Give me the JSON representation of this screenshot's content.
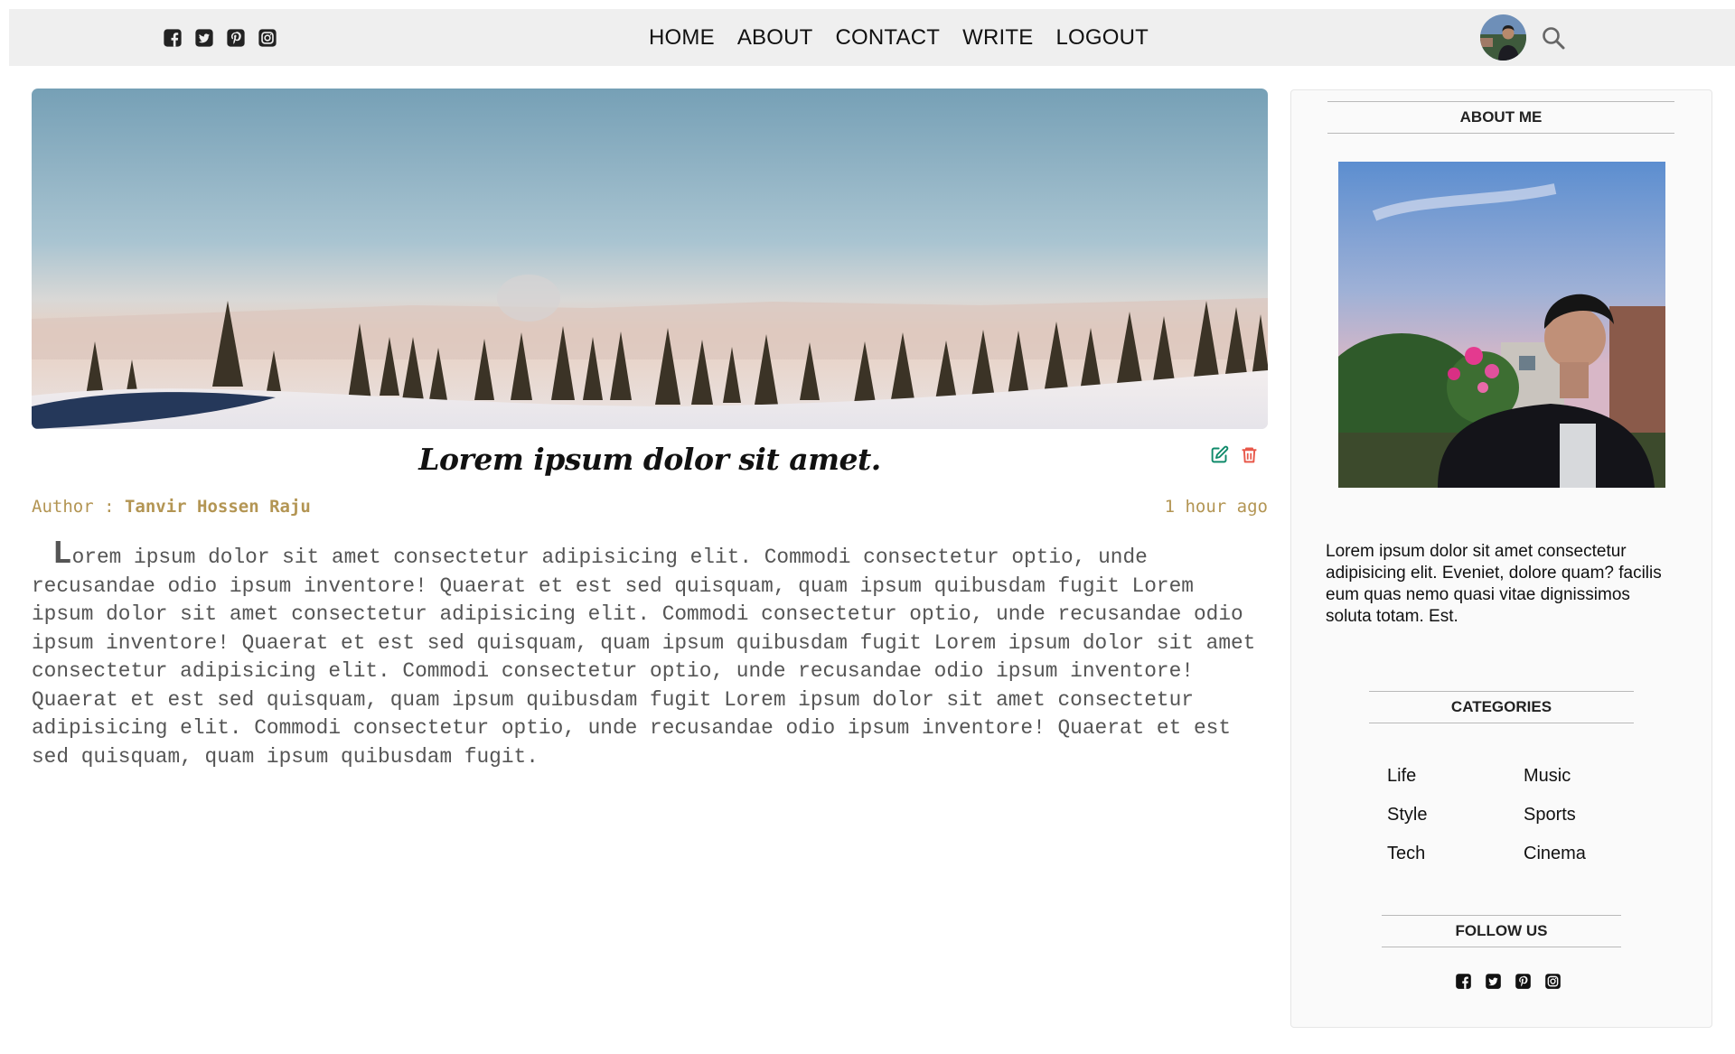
{
  "header": {
    "social_icons": [
      "facebook-icon",
      "twitter-icon",
      "pinterest-icon",
      "instagram-icon"
    ],
    "nav": [
      "HOME",
      "ABOUT",
      "CONTACT",
      "WRITE",
      "LOGOUT"
    ],
    "avatar_icon": "avatar",
    "search_icon": "search-icon",
    "background_color": "#efefef"
  },
  "post": {
    "title": "Lorem ipsum dolor sit amet.",
    "author_label": "Author : ",
    "author_name": "Tanvir Hossen Raju",
    "time": "1 hour ago",
    "body": "Lorem ipsum dolor sit amet consectetur adipisicing elit. Commodi consectetur optio, unde recusandae odio ipsum inventore! Quaerat et est sed quisquam, quam ipsum quibusdam fugit Lorem ipsum dolor sit amet consectetur adipisicing elit. Commodi consectetur optio, unde recusandae odio ipsum inventore! Quaerat et est sed quisquam, quam ipsum quibusdam fugit Lorem ipsum dolor sit amet consectetur adipisicing elit. Commodi consectetur optio, unde recusandae odio ipsum inventore! Quaerat et est sed quisquam, quam ipsum quibusdam fugit Lorem ipsum dolor sit amet consectetur adipisicing elit. Commodi consectetur optio, unde recusandae odio ipsum inventore! Quaerat et est sed quisquam, quam ipsum quibusdam fugit.",
    "actions": [
      "edit-icon",
      "delete-icon"
    ],
    "edit_color": "#0f8a6a",
    "delete_color": "#e8584a",
    "meta_color": "#b39553"
  },
  "sidebar": {
    "about_heading": "ABOUT ME",
    "about_text": "Lorem ipsum dolor sit amet consectetur adipisicing elit. Eveniet, dolore quam? facilis eum quas nemo quasi vitae dignissimos soluta totam. Est.",
    "categories_heading": "CATEGORIES",
    "categories": [
      "Life",
      "Music",
      "Style",
      "Sports",
      "Tech",
      "Cinema"
    ],
    "follow_heading": "FOLLOW US",
    "follow_icons": [
      "facebook-icon",
      "twitter-icon",
      "pinterest-icon",
      "instagram-icon"
    ]
  }
}
